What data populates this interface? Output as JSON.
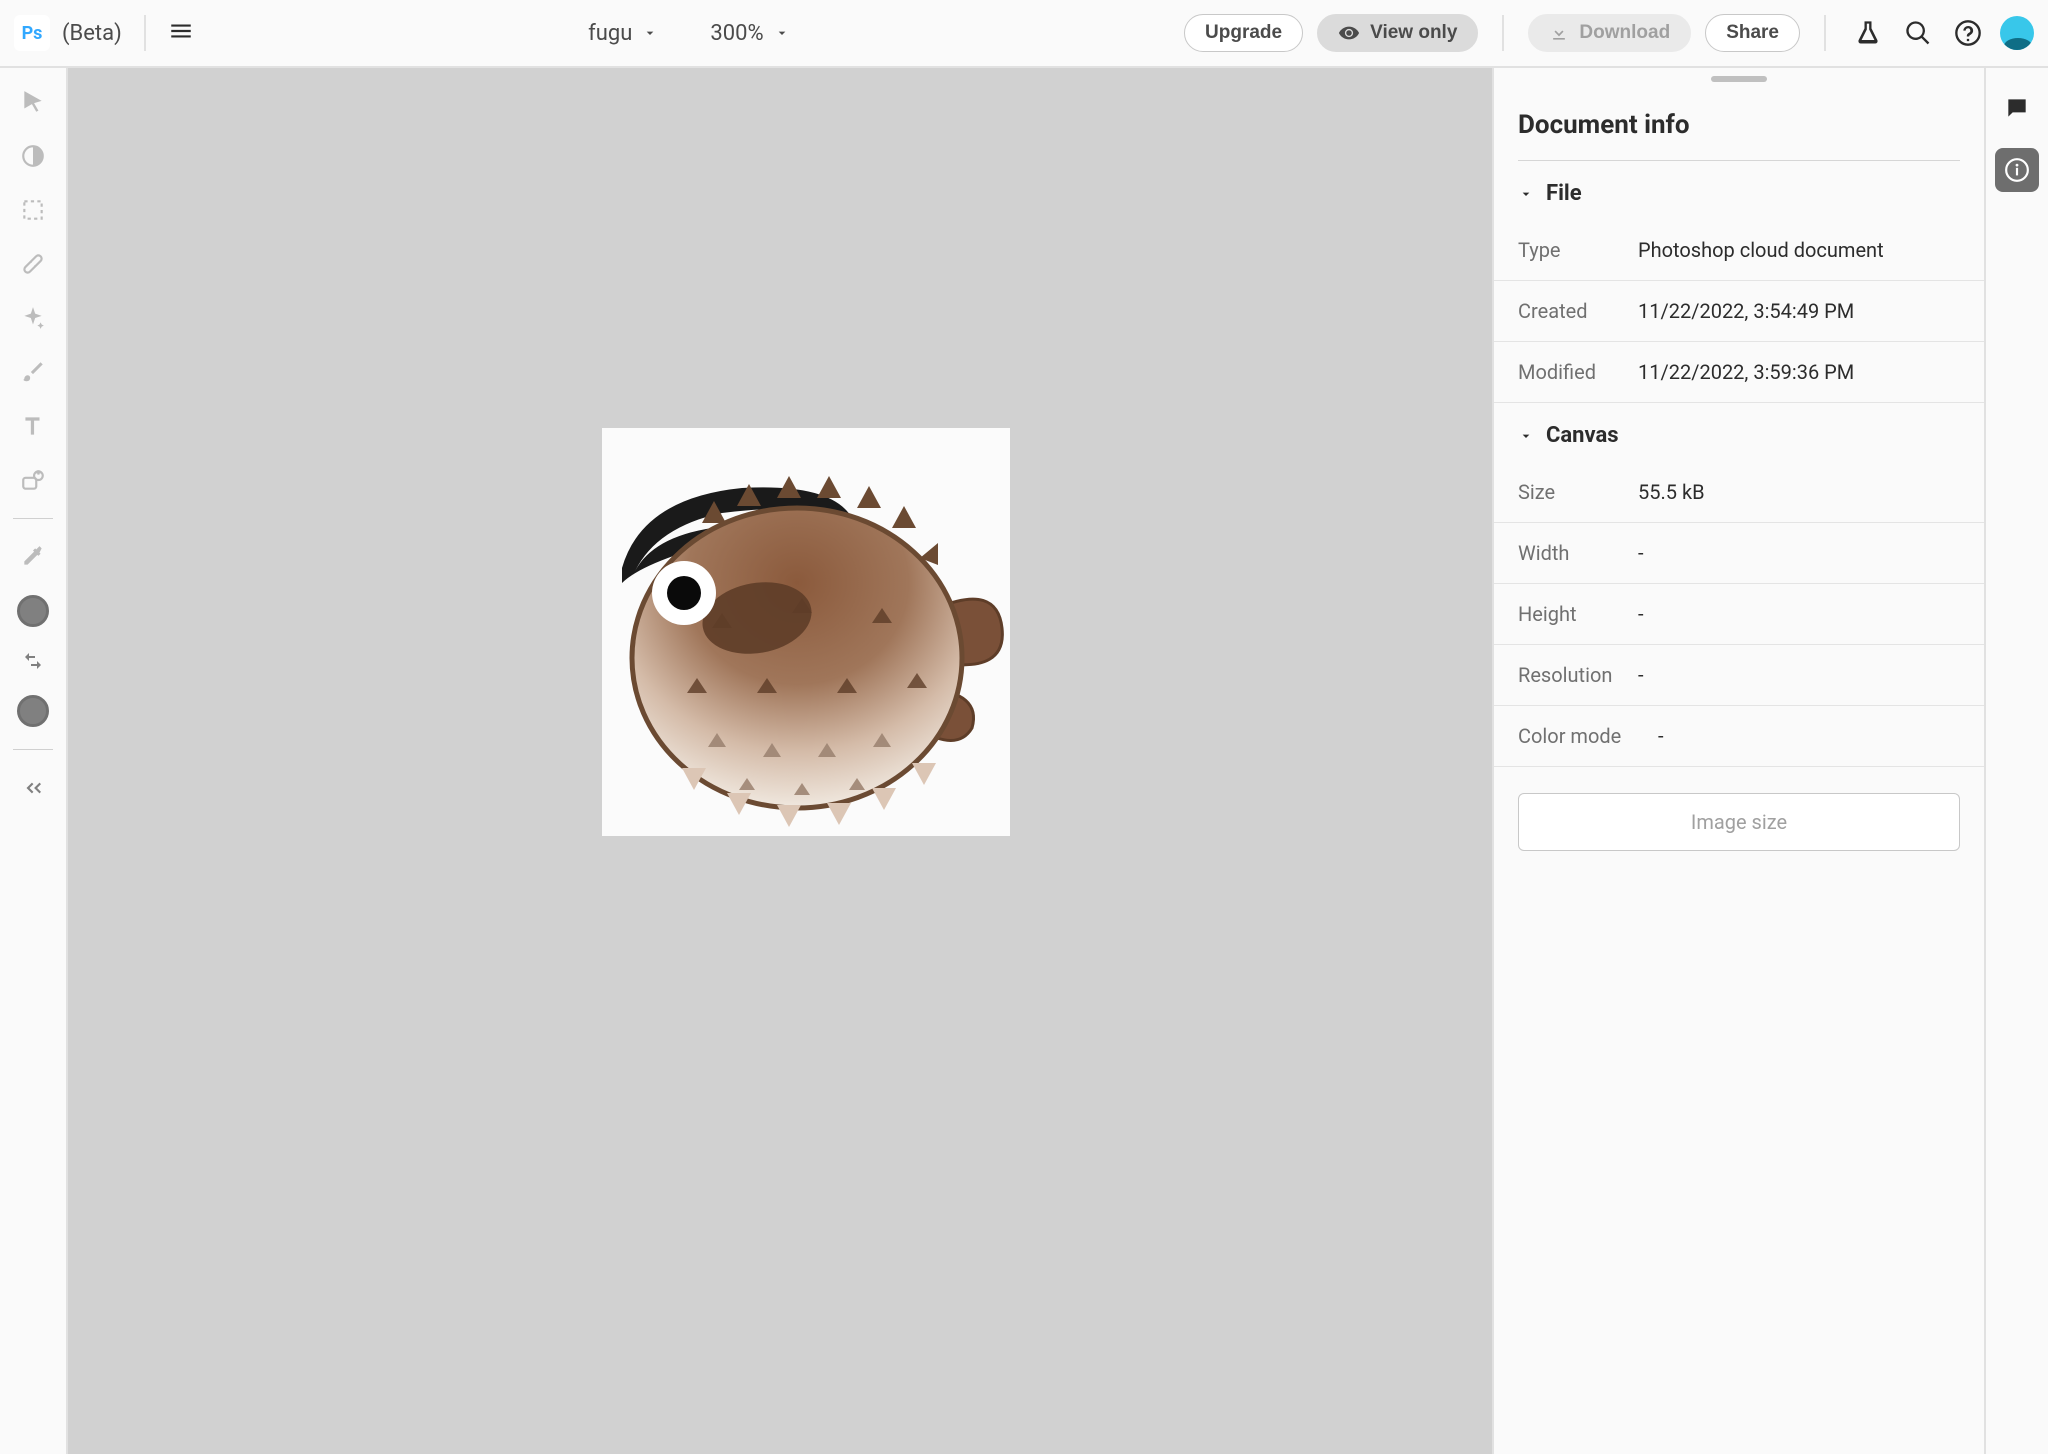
{
  "app": {
    "logo": "Ps",
    "beta": "(Beta)"
  },
  "document": {
    "name": "fugu",
    "zoom": "300%"
  },
  "topbar": {
    "upgrade": "Upgrade",
    "viewonly": "View only",
    "download": "Download",
    "share": "Share"
  },
  "panel": {
    "title": "Document info",
    "file": {
      "heading": "File",
      "type_label": "Type",
      "type_value": "Photoshop cloud document",
      "created_label": "Created",
      "created_value": "11/22/2022, 3:54:49 PM",
      "modified_label": "Modified",
      "modified_value": "11/22/2022, 3:59:36 PM"
    },
    "canvas": {
      "heading": "Canvas",
      "size_label": "Size",
      "size_value": "55.5 kB",
      "width_label": "Width",
      "width_value": "-",
      "height_label": "Height",
      "height_value": "-",
      "resolution_label": "Resolution",
      "resolution_value": "-",
      "colormode_label": "Color mode",
      "colormode_value": "-"
    },
    "image_size_btn": "Image size"
  }
}
